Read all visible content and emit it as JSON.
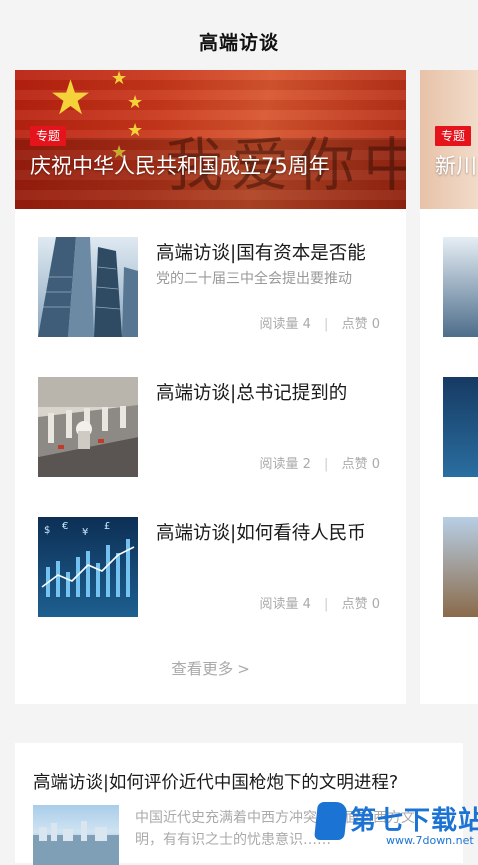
{
  "header": {
    "title": "高端访谈"
  },
  "featured": {
    "badge": "专题",
    "title": "庆祝中华人民共和国成立75周年",
    "banner_art_text": "我爱你中国",
    "articles": [
      {
        "title": "高端访谈|国有资本是否能",
        "summary": "党的二十届三中全会提出要推动",
        "reads_label": "阅读量",
        "reads": "4",
        "likes_label": "点赞",
        "likes": "0",
        "thumb_icon": "skyscraper-photo"
      },
      {
        "title": "高端访谈|总书记提到的",
        "summary": "",
        "reads_label": "阅读量",
        "reads": "2",
        "likes_label": "点赞",
        "likes": "0",
        "thumb_icon": "factory-robot-photo"
      },
      {
        "title": "高端访谈|如何看待人民币",
        "summary": "",
        "reads_label": "阅读量",
        "reads": "4",
        "likes_label": "点赞",
        "likes": "0",
        "thumb_icon": "currency-chart-photo"
      }
    ],
    "more_label": "查看更多"
  },
  "next_card": {
    "badge": "专题",
    "title_partial": "新川"
  },
  "bottom_article": {
    "title": "高端访谈|如何评价近代中国枪炮下的文明进程?",
    "summary": "中国近代史充满着中西方冲突……面对西方文明，有有识之士的忧患意识……"
  },
  "watermark": {
    "text": "第七下载站",
    "url": "www.7down.net"
  },
  "colors": {
    "badge": "#e5141c",
    "watermark": "#1b74d3"
  }
}
